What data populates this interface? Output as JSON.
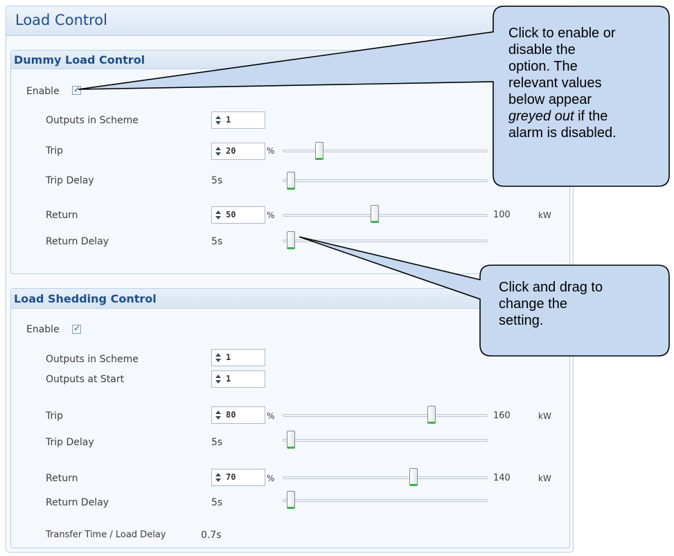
{
  "page": {
    "title": "Load Control"
  },
  "dummy": {
    "title": "Dummy Load Control",
    "enable": {
      "label": "Enable",
      "checked": true
    },
    "outputs_in_scheme": {
      "label": "Outputs in Scheme",
      "value": "1"
    },
    "trip": {
      "label": "Trip",
      "value": "20",
      "unit": "%",
      "level": 0.18
    },
    "trip_delay": {
      "label": "Trip Delay",
      "value": "5s",
      "level": 0.0
    },
    "return": {
      "label": "Return",
      "value": "50",
      "unit": "%",
      "level": 0.45,
      "max": "100",
      "max_unit": "kW"
    },
    "return_delay": {
      "label": "Return Delay",
      "value": "5s",
      "level": 0.0
    }
  },
  "shedding": {
    "title": "Load Shedding Control",
    "enable": {
      "label": "Enable",
      "checked": true
    },
    "outputs_in_scheme": {
      "label": "Outputs in Scheme",
      "value": "1"
    },
    "outputs_at_start": {
      "label": "Outputs at Start",
      "value": "1"
    },
    "trip": {
      "label": "Trip",
      "value": "80",
      "unit": "%",
      "level": 0.73,
      "max": "160",
      "max_unit": "kW"
    },
    "trip_delay": {
      "label": "Trip Delay",
      "value": "5s",
      "level": 0.0
    },
    "return": {
      "label": "Return",
      "value": "70",
      "unit": "%",
      "level": 0.63,
      "max": "140",
      "max_unit": "kW"
    },
    "return_delay": {
      "label": "Return Delay",
      "value": "5s",
      "level": 0.0
    },
    "transfer": {
      "label": "Transfer Time / Load Delay",
      "value": "0.7s"
    }
  },
  "callouts": {
    "enable": {
      "line1": "Click to enable or",
      "line2": "disable the",
      "line3": "option. The",
      "line4": "relevant values",
      "line5": "below appear",
      "line6_italic": "greyed out",
      "line6_rest": " if the",
      "line7": "alarm is disabled."
    },
    "drag": {
      "line1": "Click and drag to",
      "line2": "change the",
      "line3": "setting."
    }
  },
  "colors": {
    "accent": "#1e4f8c",
    "callout_fill": "#c6d9f1",
    "thumb_green": "#3db347"
  }
}
